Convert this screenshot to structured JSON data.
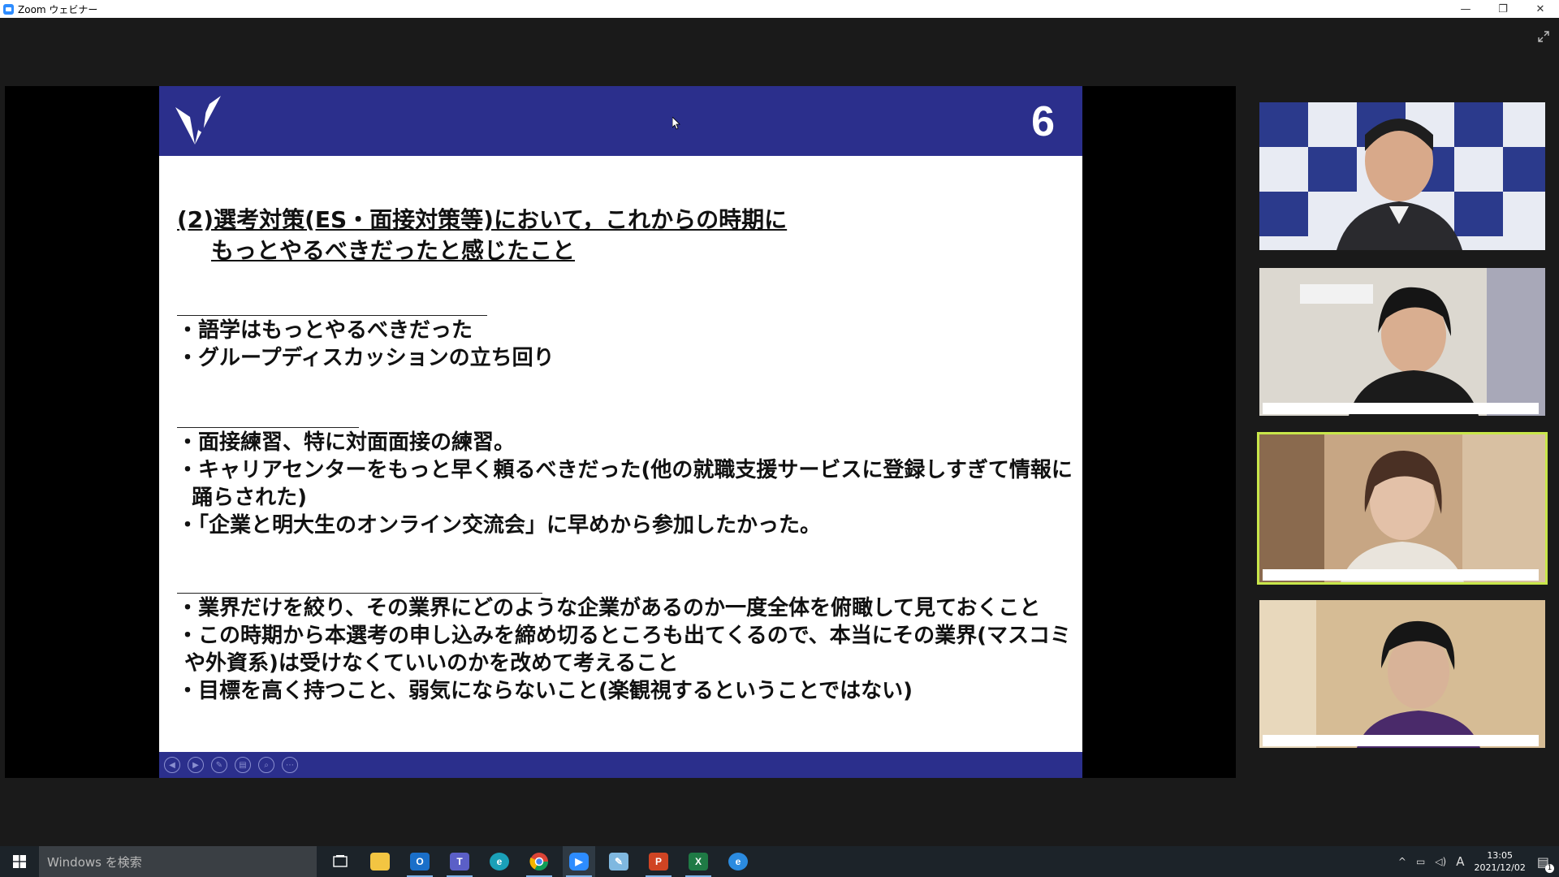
{
  "window": {
    "title": "Zoom ウェビナー",
    "buttons": {
      "minimize": "—",
      "restore": "❐",
      "close": "✕"
    }
  },
  "slide": {
    "number": "6",
    "title_line1": "(2)選考対策(ES・面接対策等)において，これからの時期に",
    "title_line2": "もっとやるべきだったと感じたこと",
    "sections": [
      {
        "bullets": [
          "・語学はもっとやるべきだった",
          "・グループディスカッションの立ち回り"
        ]
      },
      {
        "bullets": [
          "・面接練習、特に対面面接の練習。",
          "・キャリアセンターをもっと早く頼るべきだった(他の就職支援サービスに登録しすぎて情報に",
          "  踊らされた)",
          "・「企業と明大生のオンライン交流会」に早めから参加したかった。"
        ]
      },
      {
        "bullets": [
          "・業界だけを絞り、その業界にどのような企業があるのか一度全体を俯瞰して見ておくこと",
          "・この時期から本選考の申し込みを締め切るところも出てくるので、本当にその業界(マスコミ",
          " や外資系)は受けなくていいのかを改めて考えること",
          "・目標を高く持つこと、弱気にならないこと(楽観視するということではない)"
        ]
      }
    ],
    "controls": [
      "prev-icon",
      "next-icon",
      "pen-icon",
      "slides-icon",
      "zoom-icon",
      "more-icon"
    ]
  },
  "participants": [
    {
      "id": "p1",
      "bg": "#dfe3ee"
    },
    {
      "id": "p2",
      "bg": "#d9d4cc"
    },
    {
      "id": "p3",
      "bg": "#c9a98a",
      "active_speaker": true
    },
    {
      "id": "p4",
      "bg": "#d4b992"
    }
  ],
  "taskbar": {
    "search_placeholder": "Windows を検索",
    "apps": [
      {
        "name": "task-view",
        "color": "#1c2329",
        "glyph": "▭"
      },
      {
        "name": "file-explorer",
        "color": "#f3c542",
        "glyph": ""
      },
      {
        "name": "outlook",
        "color": "#1a6fc9",
        "glyph": "O"
      },
      {
        "name": "teams",
        "color": "#5b5fc7",
        "glyph": "T"
      },
      {
        "name": "edge",
        "color": "#1aa0b8",
        "glyph": "e"
      },
      {
        "name": "chrome",
        "color": "#e0b21f",
        "glyph": "●"
      },
      {
        "name": "zoom",
        "color": "#2d8cff",
        "glyph": "▶"
      },
      {
        "name": "notepad",
        "color": "#7fb8e0",
        "glyph": "✎"
      },
      {
        "name": "powerpoint",
        "color": "#d04423",
        "glyph": "P"
      },
      {
        "name": "excel",
        "color": "#1f7a45",
        "glyph": "X"
      },
      {
        "name": "internet-explorer",
        "color": "#2b8be0",
        "glyph": "e"
      }
    ],
    "tray": {
      "ime": "A",
      "time": "13:05",
      "date": "2021/12/02",
      "notification_count": "1"
    }
  }
}
